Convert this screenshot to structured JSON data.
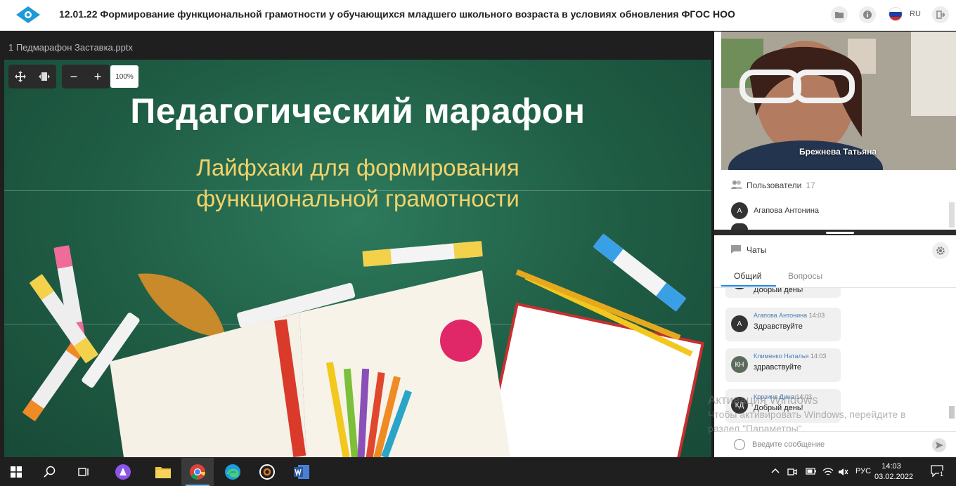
{
  "header": {
    "title": "12.01.22 Формирование функциональной грамотности у обучающихся младшего школьного возраста в условиях обновления ФГОС НОО",
    "lang": "RU",
    "icons": [
      "folder-icon",
      "info-icon",
      "flag-ru-icon",
      "exit-icon"
    ]
  },
  "presentation": {
    "file_name": "1 Педмарафон Заставка.pptx",
    "zoom": "100%",
    "controls": {
      "zoom_out": "−",
      "zoom_in": "+"
    },
    "slide": {
      "title": "Педагогический марафон",
      "subtitle_line1": "Лайфхаки для формирования",
      "subtitle_line2": "функциональной грамотности"
    }
  },
  "video": {
    "speaker_name": "Брежнева Татьяна"
  },
  "users": {
    "label": "Пользователи",
    "count": "17",
    "items": [
      {
        "initial": "А",
        "name": "Агапова Антонина"
      }
    ]
  },
  "chats": {
    "label": "Чаты",
    "tabs": [
      {
        "label": "Общий",
        "active": true
      },
      {
        "label": "Вопросы",
        "active": false
      }
    ],
    "messages": [
      {
        "text": "Добрый день!"
      },
      {
        "initials": "А",
        "author": "Агапова Антонина",
        "time": "14:03",
        "text": "Здравствуйте"
      },
      {
        "initials": "КН",
        "author": "Клименко Наталья",
        "time": "14:03",
        "text": "здравствуйте"
      },
      {
        "initials": "КД",
        "author": "Корзина Дина",
        "time": "14:03",
        "text": "Добрый день!"
      }
    ],
    "input_placeholder": "Введите сообщение"
  },
  "watermark": {
    "line1": "Активация Windows",
    "line2": "Чтобы активировать Windows, перейдите в",
    "line3": "раздел \"Параметры\"."
  },
  "taskbar": {
    "lang": "РУС",
    "time": "14:03",
    "date": "03.02.2022",
    "notifications": "1"
  },
  "colors": {
    "accent": "#1e88e5",
    "slide_bg": "#1f5c44",
    "subtitle": "#f3d26a"
  }
}
